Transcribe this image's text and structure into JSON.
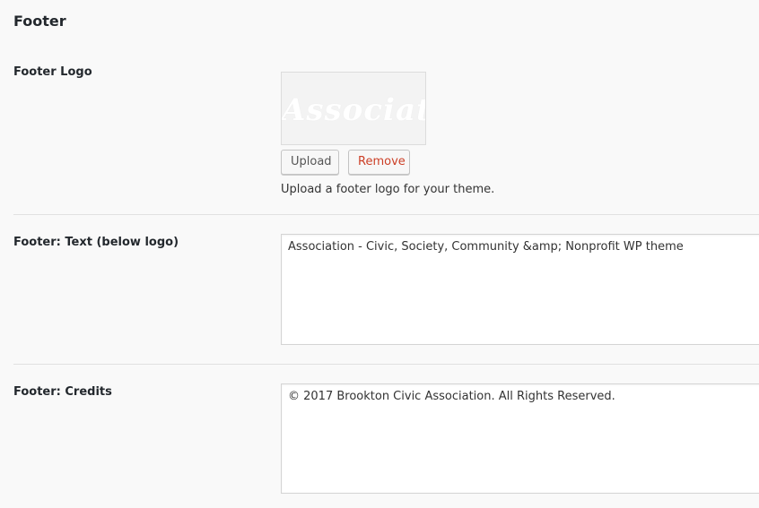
{
  "section": {
    "title": "Footer"
  },
  "footer_logo": {
    "label": "Footer Logo",
    "preview_text": "Associati",
    "upload_label": "Upload",
    "remove_label": "Remove",
    "description": "Upload a footer logo for your theme."
  },
  "footer_text": {
    "label": "Footer: Text (below logo)",
    "value": "Association - Civic, Society, Community &amp; Nonprofit WP theme"
  },
  "footer_credits": {
    "label": "Footer: Credits",
    "value": "© 2017 Brookton Civic Association. All Rights Reserved."
  },
  "colors": {
    "background": "#f9f9f9",
    "remove_text": "#cc3f26",
    "divider": "#e1e1e1"
  }
}
